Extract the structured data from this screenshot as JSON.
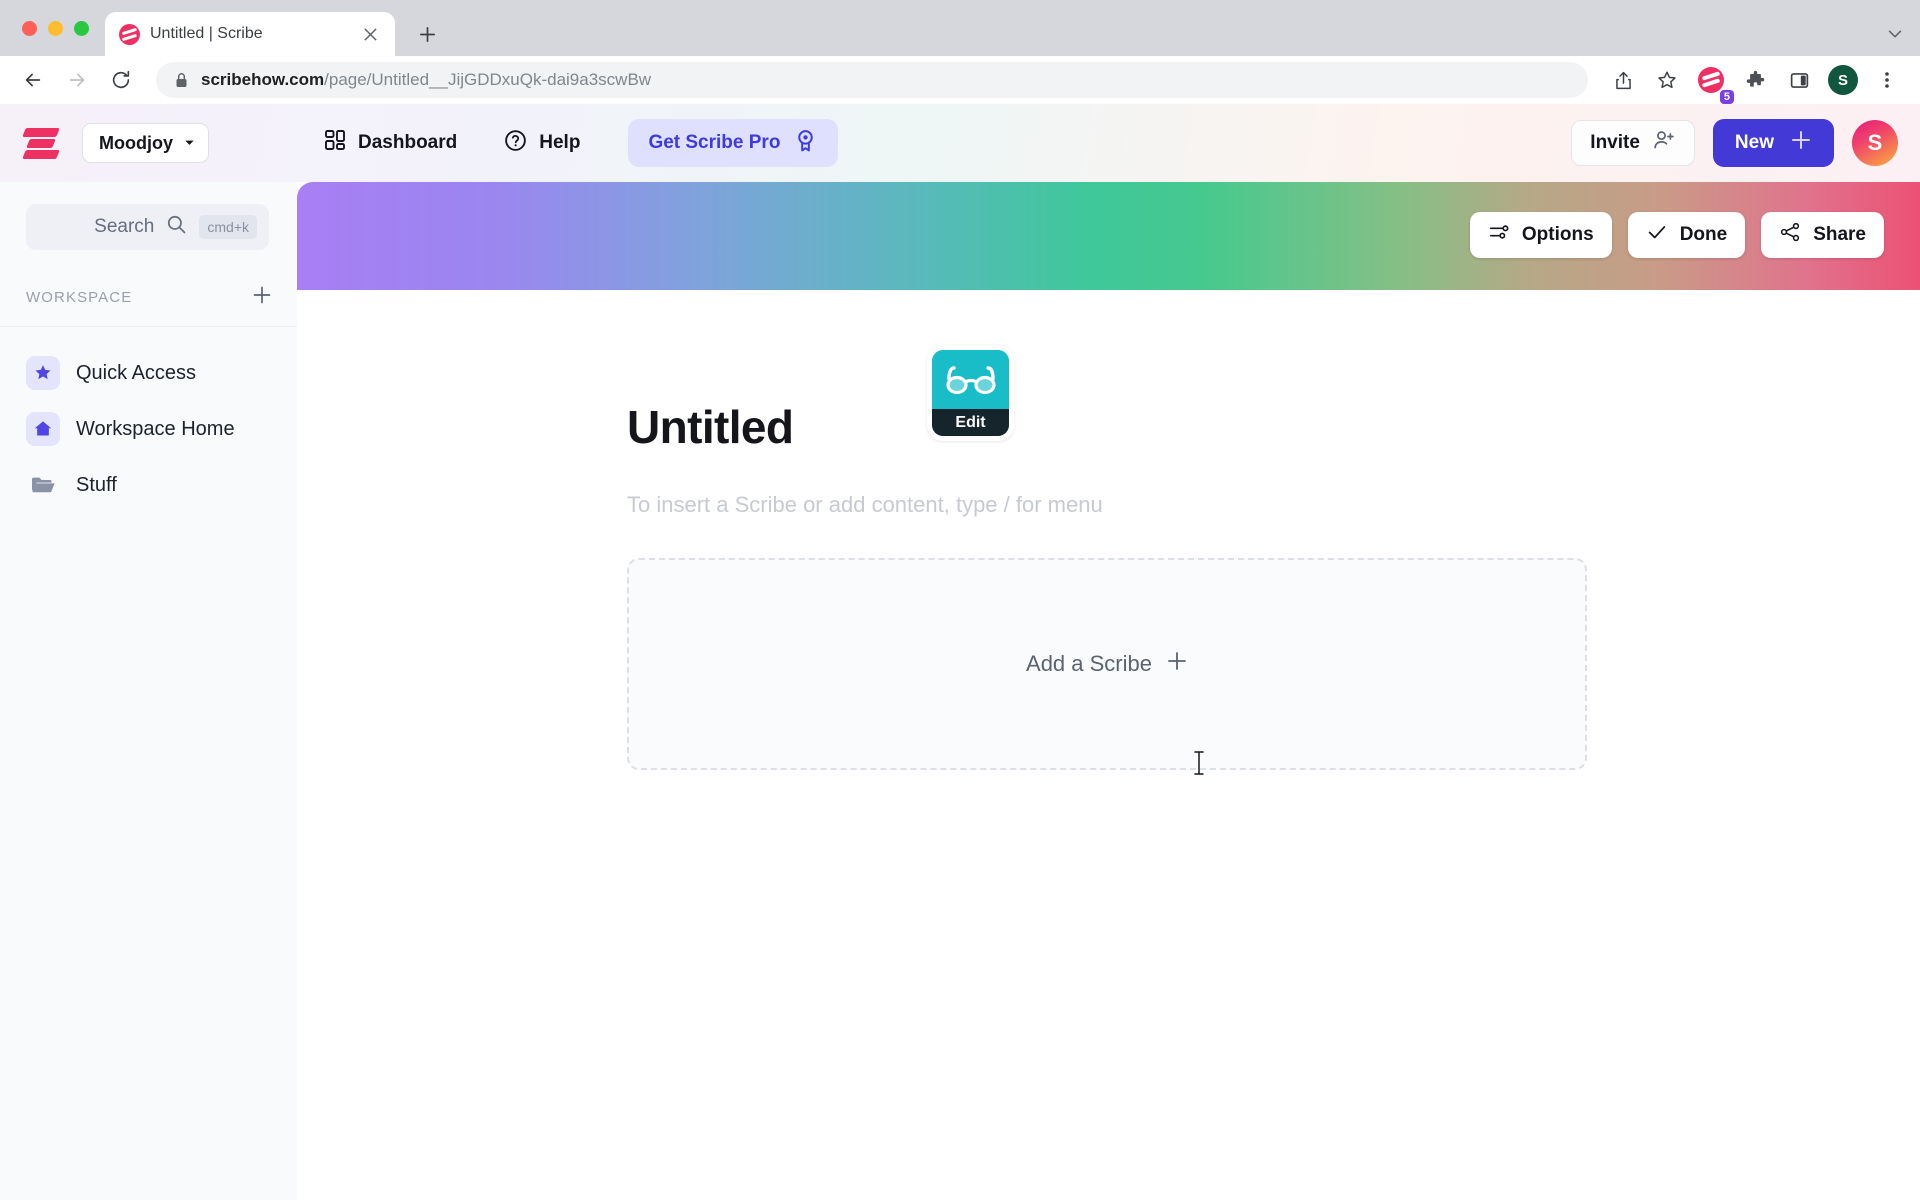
{
  "browser": {
    "tab": {
      "title": "Untitled | Scribe",
      "favicon": "scribe-favicon",
      "close_icon": "close-icon"
    },
    "new_tab_label": "+",
    "tabstrip_menu_icon": "chevron-down-icon",
    "nav": {
      "back_icon": "back-arrow-icon",
      "forward_icon": "forward-arrow-icon",
      "reload_icon": "reload-icon"
    },
    "omnibox": {
      "lock_icon": "lock-icon",
      "url_domain": "scribehow.com",
      "url_path": "/page/Untitled__JijGDDxuQk-dai9a3scwBw",
      "share_icon": "share-icon",
      "bookmark_icon": "star-icon"
    },
    "extensions": {
      "scribe_icon": "scribe-extension-icon",
      "scribe_badge": "5",
      "puzzle_icon": "extensions-puzzle-icon",
      "sidepanel_icon": "side-panel-icon"
    },
    "profile": {
      "initial": "S",
      "color": "#115740"
    },
    "menu_icon": "three-dot-menu-icon"
  },
  "appbar": {
    "logo": "scribe-logo",
    "workspace": {
      "name": "Moodjoy",
      "chevron": "chevron-down-icon"
    },
    "dashboard": {
      "label": "Dashboard",
      "icon": "dashboard-grid-icon"
    },
    "help": {
      "label": "Help",
      "icon": "question-circle-icon"
    },
    "pro": {
      "label": "Get Scribe Pro",
      "icon": "award-ribbon-icon",
      "color": "#3d3ae0",
      "bg": "#dfe0fd"
    },
    "invite": {
      "label": "Invite",
      "icon": "person-add-icon"
    },
    "new": {
      "label": "New",
      "icon": "plus-icon",
      "color": "#4339d6"
    },
    "avatar": {
      "initial": "S"
    }
  },
  "sidebar": {
    "search": {
      "label": "Search",
      "icon": "search-icon",
      "shortcut": "cmd+k"
    },
    "section_title": "WORKSPACE",
    "add_icon": "plus-icon",
    "items": [
      {
        "label": "Quick Access",
        "icon": "star-icon"
      },
      {
        "label": "Workspace Home",
        "icon": "home-icon"
      },
      {
        "label": "Stuff",
        "icon": "folder-icon"
      }
    ]
  },
  "banner": {
    "actions": [
      {
        "label": "Options",
        "icon": "sliders-icon"
      },
      {
        "label": "Done",
        "icon": "check-icon"
      },
      {
        "label": "Share",
        "icon": "share-nodes-icon"
      }
    ]
  },
  "document": {
    "page_icon": {
      "emoji": "glasses-icon",
      "bg": "#19bdc8",
      "edit_label": "Edit"
    },
    "title": "Untitled",
    "placeholder": "To insert a Scribe or add content, type / for menu",
    "dropzone": {
      "label": "Add a Scribe",
      "icon": "plus-icon"
    },
    "cursor_icon": "text-caret-icon"
  }
}
